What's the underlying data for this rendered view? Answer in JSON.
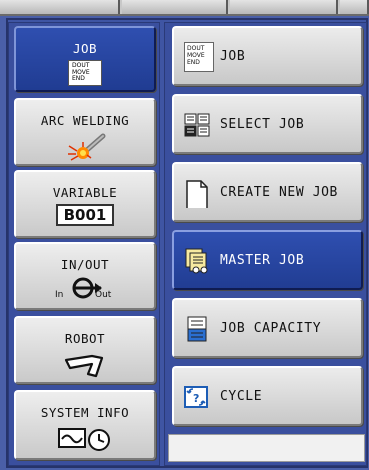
{
  "main_menu": {
    "items": [
      {
        "label": "JOB",
        "icon": "job-doc-icon",
        "icon_text": [
          "DOUT",
          "MOVE",
          "END"
        ],
        "selected": true
      },
      {
        "label": "ARC WELDING",
        "icon": "arc-welding-icon",
        "selected": false
      },
      {
        "label": "VARIABLE",
        "icon": "variable-icon",
        "icon_text": "B001",
        "selected": false
      },
      {
        "label": "IN/OUT",
        "icon": "in-out-icon",
        "icon_in": "In",
        "icon_out": "Out",
        "selected": false
      },
      {
        "label": "ROBOT",
        "icon": "robot-arm-icon",
        "selected": false
      },
      {
        "label": "SYSTEM INFO",
        "icon": "system-info-icon",
        "selected": false
      }
    ]
  },
  "sub_menu": {
    "items": [
      {
        "label": "JOB",
        "icon": "job-doc-icon",
        "icon_text": [
          "DOUT",
          "MOVE",
          "END"
        ],
        "selected": false
      },
      {
        "label": "SELECT JOB",
        "icon": "select-job-icon",
        "selected": false
      },
      {
        "label": "CREATE NEW JOB",
        "icon": "new-document-icon",
        "selected": false
      },
      {
        "label": "MASTER JOB",
        "icon": "master-job-icon",
        "selected": true
      },
      {
        "label": "JOB CAPACITY",
        "icon": "job-capacity-icon",
        "selected": false
      },
      {
        "label": "CYCLE",
        "icon": "cycle-icon",
        "selected": false
      }
    ]
  },
  "colors": {
    "background": "#4a5fa8",
    "selected": "#2a48a6",
    "button": "#d9d9d9"
  }
}
